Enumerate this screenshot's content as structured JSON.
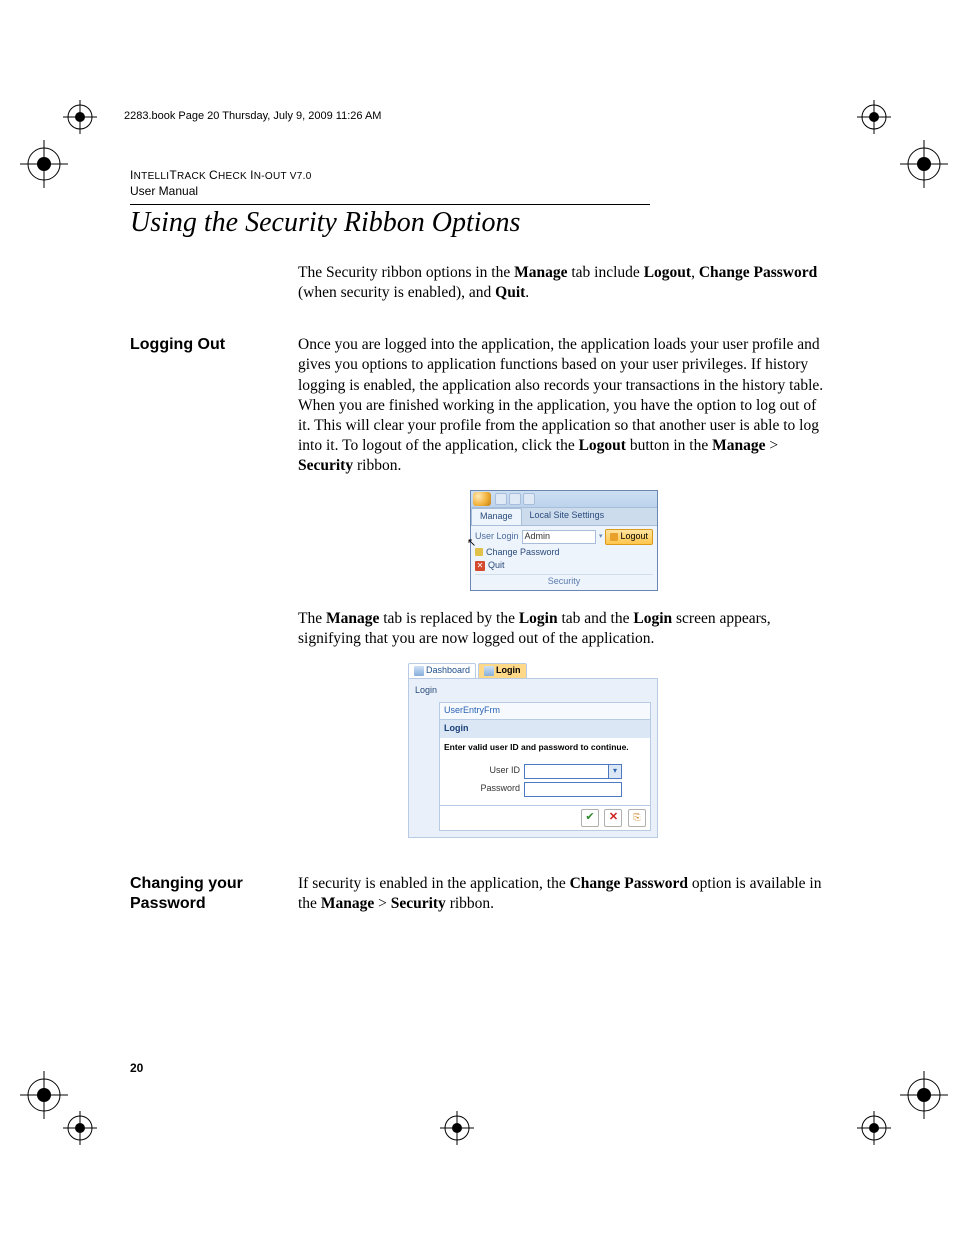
{
  "bookinfo": "2283.book  Page 20  Thursday, July 9, 2009  11:26 AM",
  "doc_header_smallcaps1": "I",
  "doc_header_rest1": "NTELLI",
  "doc_header_smallcaps2": "T",
  "doc_header_rest2": "RACK ",
  "doc_header_smallcaps3": "C",
  "doc_header_rest3": "HECK ",
  "doc_header_smallcaps4": "I",
  "doc_header_rest4": "N",
  "doc_header_dash": "-O",
  "doc_header_rest5": "UT V",
  "doc_header_ver": "7.0",
  "doc_sub": "User Manual",
  "page_title": "Using the Security Ribbon Options",
  "intro": {
    "t1": "The Security ribbon options in the ",
    "b1": "Manage",
    "t2": " tab include ",
    "b2": "Logout",
    "t3": ", ",
    "b3": "Change Password",
    "t4": " (when security is enabled), and ",
    "b4": "Quit",
    "t5": "."
  },
  "logging_out": {
    "heading": "Logging Out",
    "p1a": "Once you are logged into the application, the application loads your user profile and gives you options to application functions based on your user privileges. If history logging is enabled, the application also records your transactions in the history table. When you are finished working in the application, you have the option to log out of it. This will clear your profile from the application so that another user is able to log into it. To logout of the application, click the ",
    "b1": "Logout",
    "p1b": " button in the ",
    "b2": "Manage",
    "p1c": " > ",
    "b3": "Security",
    "p1d": " ribbon.",
    "p2a": "The ",
    "b4": "Manage",
    "p2b": " tab is replaced by the ",
    "b5": "Login",
    "p2c": " tab and the ",
    "b6": "Login",
    "p2d": " screen appears, signifying that you are now logged out of the application."
  },
  "ribbon": {
    "tab_manage": "Manage",
    "tab_local": "Local Site Settings",
    "user_login_label": "User Login",
    "user_login_value": "Admin",
    "logout": "Logout",
    "change_password": "Change Password",
    "quit": "Quit",
    "group": "Security"
  },
  "login_shot": {
    "tab_dashboard": "Dashboard",
    "tab_login": "Login",
    "caption": "Login",
    "frm_title": "UserEntryFrm",
    "frm_head": "Login",
    "frm_instr": "Enter valid user ID and password to continue.",
    "user_id_label": "User ID",
    "password_label": "Password",
    "dd_glyph": "▾"
  },
  "changing": {
    "heading": "Changing your Password",
    "t1": "If security is enabled in the application, the ",
    "b1": "Change Password",
    "t2": " option is available in the ",
    "b2": "Manage",
    "t3": " > ",
    "b3": "Security",
    "t4": " ribbon."
  },
  "page_num": "20"
}
